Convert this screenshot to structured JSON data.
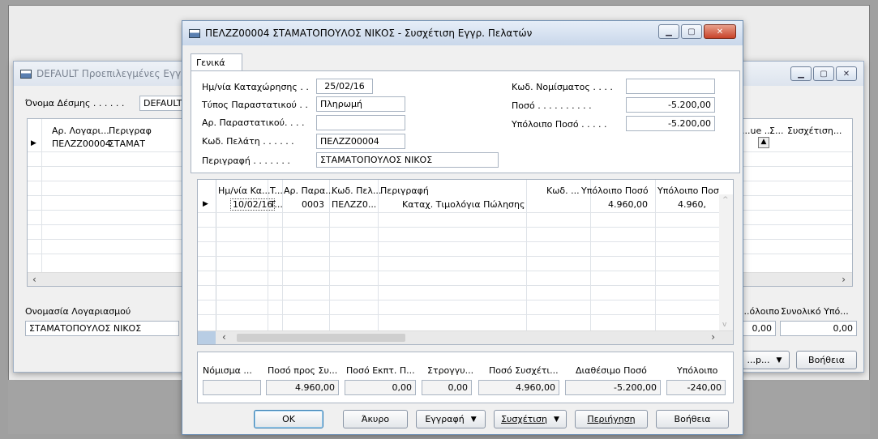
{
  "background_window": {
    "title": "DEFAULT Προεπιλεγμένες Εγγρ",
    "journal_label": "Όνομα Δέσμης . . . . . .",
    "journal_value": "DEFAULT",
    "grid_headers": [
      "Αρ. Λογαρι...",
      "Περιγραφ"
    ],
    "grid_row": [
      "ΠΕΛΖΖ00004",
      "ΣΤΑΜΑΤ"
    ],
    "right_headers": [
      "...ue ...",
      "Σ...",
      "Συσχέτιση..."
    ],
    "account_name_label": "Ονομασία Λογαριασμού",
    "account_name_value": "ΣΤΑΜΑΤΟΠΟΥΛΟΣ ΝΙΚΟΣ",
    "balance_label": "...όλοιπο",
    "total_balance_label": "Συνολικό Υπό...",
    "balance_value": "0,00",
    "total_balance_value": "0,00",
    "partial_button": "...p...",
    "help_button": "Βοήθεια"
  },
  "dialog": {
    "title": "ΠΕΛΖΖ00004 ΣΤΑΜΑΤΟΠΟΥΛΟΣ ΝΙΚΟΣ - Συσχέτιση Εγγρ. Πελατών",
    "tab": "Γενικά",
    "fields": {
      "posting_date_label": "Ημ/νία Καταχώρησης . .",
      "posting_date_value": "25/02/16",
      "doc_type_label": "Τύπος Παραστατικού . .",
      "doc_type_value": "Πληρωμή",
      "doc_no_label": "Αρ. Παραστατικού. . . .",
      "doc_no_value": "",
      "customer_no_label": "Κωδ. Πελάτη . . . . . .",
      "customer_no_value": "ΠΕΛΖΖ00004",
      "description_label": "Περιγραφή . . . . . . .",
      "description_value": "ΣΤΑΜΑΤΟΠΟΥΛΟΣ ΝΙΚΟΣ",
      "currency_label": "Κωδ. Νομίσματος . . . .",
      "currency_value": "",
      "amount_label": "Ποσό . . . . . . . . . .",
      "amount_value": "-5.200,00",
      "remaining_label": "Υπόλοιπο Ποσό . . . . .",
      "remaining_value": "-5.200,00"
    },
    "grid": {
      "headers": [
        "Ημ/νία Κα...",
        "T...",
        "Αρ. Παρα...",
        "Κωδ. Πελ...",
        "Περιγραφή",
        "Κωδ. ...",
        "Υπόλοιπο Ποσό",
        "Υπόλοιπο Ποσ"
      ],
      "rows": [
        [
          "10/02/16",
          "T...",
          "0003",
          "ΠΕΛΖΖ0...",
          "Καταχ. Τιμολόγια Πώλησης",
          "",
          "4.960,00",
          "4.960,"
        ]
      ]
    },
    "totals": {
      "headers": [
        "Νόμισμα ...",
        "Ποσό προς Συ...",
        "Ποσό Εκπτ. Π...",
        "Στρογγυ...",
        "Ποσό Συσχέτι...",
        "Διαθέσιμο Ποσό",
        "Υπόλοιπο"
      ],
      "values": [
        "",
        "4.960,00",
        "0,00",
        "0,00",
        "4.960,00",
        "-5.200,00",
        "-240,00"
      ]
    },
    "buttons": {
      "ok": "OK",
      "cancel": "Άκυρο",
      "entry": "Εγγραφή",
      "apply": "Συσχέτιση",
      "navigate": "Περιήγηση",
      "help": "Βοήθεια"
    }
  }
}
